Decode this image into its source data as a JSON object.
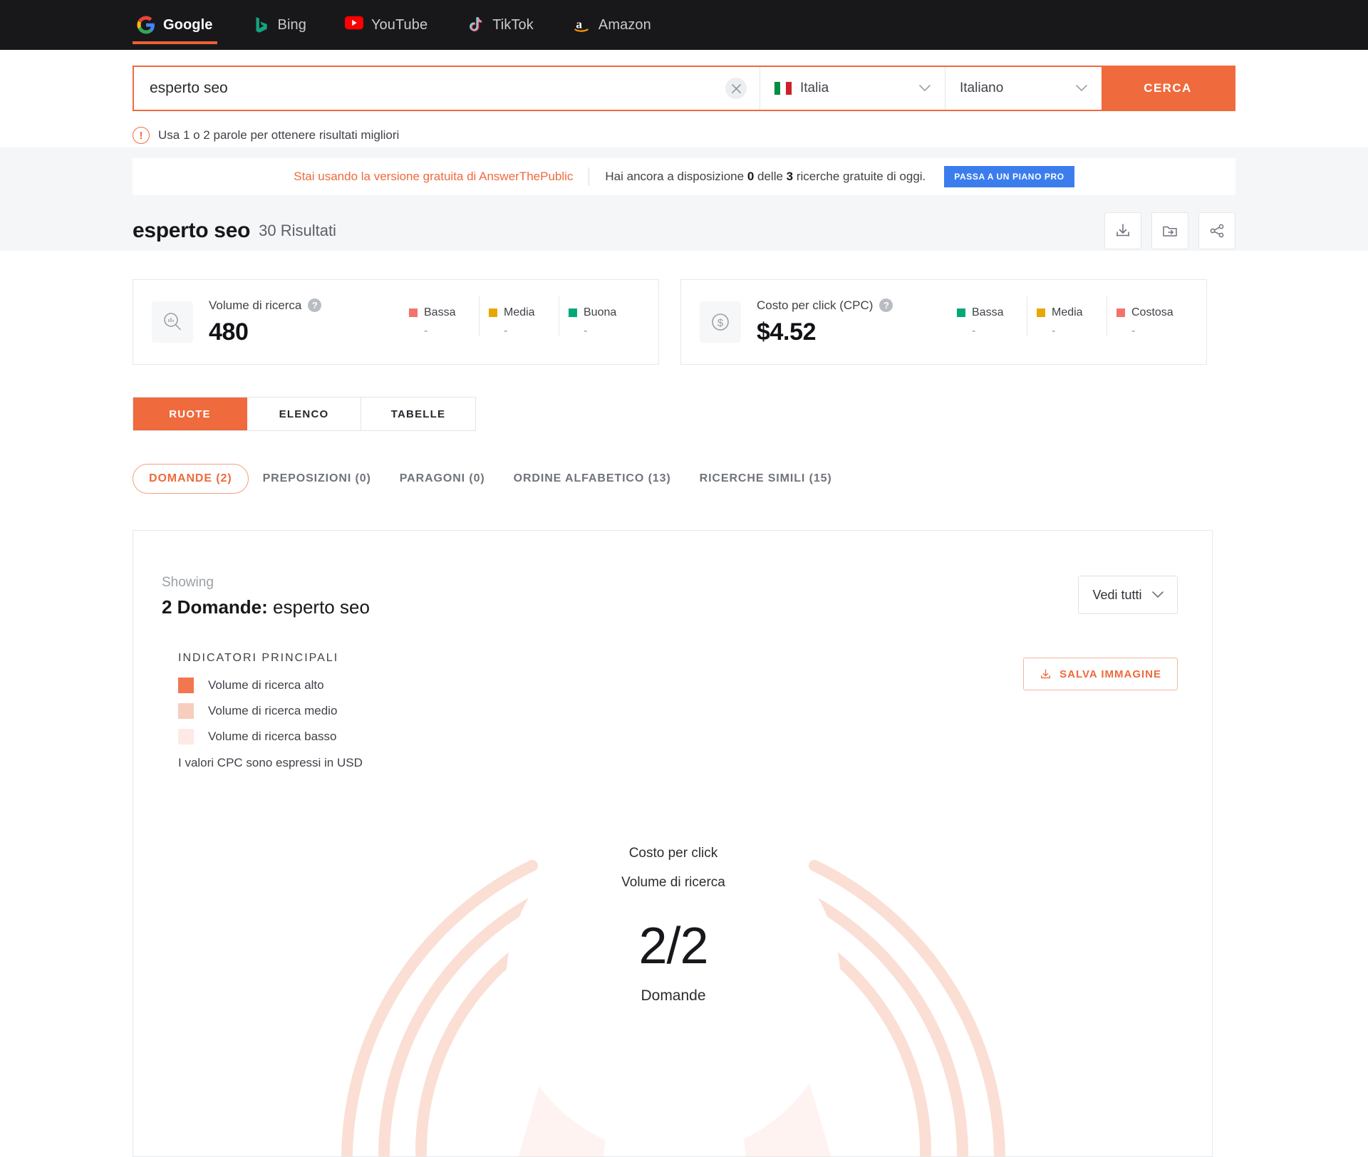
{
  "engines": [
    {
      "name": "Google",
      "icon": "google-icon",
      "active": true
    },
    {
      "name": "Bing",
      "icon": "bing-icon",
      "active": false
    },
    {
      "name": "YouTube",
      "icon": "youtube-icon",
      "active": false
    },
    {
      "name": "TikTok",
      "icon": "tiktok-icon",
      "active": false
    },
    {
      "name": "Amazon",
      "icon": "amazon-icon",
      "active": false
    }
  ],
  "search": {
    "value": "esperto seo",
    "placeholder": "esperto seo",
    "clear_icon": "close-icon",
    "country": "Italia",
    "country_flag": "italy-flag-icon",
    "language": "Italiano",
    "submit_label": "CERCA",
    "chevron_icon": "chevron-down-icon"
  },
  "hint": {
    "icon": "warning-icon",
    "text": "Usa 1 o 2 parole per ottenere risultati migliori"
  },
  "banner": {
    "free_text": "Stai usando la versione gratuita di AnswerThePublic",
    "quota_prefix": "Hai ancora a disposizione ",
    "quota_used": "0",
    "quota_middle": " delle ",
    "quota_total": "3",
    "quota_suffix": " ricerche gratuite di oggi.",
    "pro_label": "PASSA A UN PIANO PRO",
    "pro_color": "#3b7ded"
  },
  "results_header": {
    "keyword": "esperto seo",
    "count_label": "30 Risultati",
    "actions": [
      {
        "name": "download-icon",
        "label": "Download"
      },
      {
        "name": "move-to-folder-icon",
        "label": "Sposta"
      },
      {
        "name": "share-icon",
        "label": "Condividi"
      }
    ]
  },
  "cards": [
    {
      "icon": "search-volume-icon",
      "title": "Volume di ricerca",
      "help_icon": "question-mark-icon",
      "value": "480",
      "legend": [
        {
          "label": "Bassa",
          "color": "#f4726d",
          "value": "-"
        },
        {
          "label": "Media",
          "color": "#e8a700",
          "value": "-"
        },
        {
          "label": "Buona",
          "color": "#00a878",
          "value": "-"
        }
      ]
    },
    {
      "icon": "cpc-dollar-icon",
      "title": "Costo per click (CPC)",
      "help_icon": "question-mark-icon",
      "value": "$4.52",
      "legend": [
        {
          "label": "Bassa",
          "color": "#00a878",
          "value": "-"
        },
        {
          "label": "Media",
          "color": "#e8a700",
          "value": "-"
        },
        {
          "label": "Costosa",
          "color": "#f4726d",
          "value": "-"
        }
      ]
    }
  ],
  "view_tabs": [
    {
      "label": "RUOTE",
      "active": true
    },
    {
      "label": "ELENCO",
      "active": false
    },
    {
      "label": "TABELLE",
      "active": false
    }
  ],
  "category_tabs": [
    {
      "label": "DOMANDE (2)",
      "active": true
    },
    {
      "label": "PREPOSIZIONI (0)",
      "active": false
    },
    {
      "label": "PARAGONI (0)",
      "active": false
    },
    {
      "label": "ORDINE ALFABETICO (13)",
      "active": false
    },
    {
      "label": "RICERCHE SIMILI (15)",
      "active": false
    }
  ],
  "panel": {
    "showing_label": "Showing",
    "showing_count": "2 Domande:",
    "showing_keyword": "esperto seo",
    "view_all_label": "Vedi tutti",
    "view_all_icon": "chevron-down-icon",
    "indicators_title": "INDICATORI PRINCIPALI",
    "indicators": [
      {
        "label": "Volume di ricerca alto",
        "color": "#f2764f"
      },
      {
        "label": "Volume di ricerca medio",
        "color": "#f7cdbd"
      },
      {
        "label": "Volume di ricerca basso",
        "color": "#fdeae4"
      }
    ],
    "cpc_note": "I valori CPC sono espressi in USD",
    "save_image_label": "SALVA IMMAGINE",
    "save_image_icon": "download-icon"
  },
  "wheel": {
    "legend_line1": "Costo per click",
    "legend_line2": "Volume di ricerca",
    "fraction": "2/2",
    "fraction_sub": "Domande",
    "arc_color": "#fbdfd4"
  },
  "chart_data": {
    "type": "pie",
    "title": "2/2 Domande",
    "categories": [
      "Domande"
    ],
    "values": [
      2
    ],
    "total": 2,
    "arc_segments": 2,
    "legend": [
      "Costo per click",
      "Volume di ricerca"
    ],
    "colors": [
      "#f2764f",
      "#f7cdbd",
      "#fdeae4"
    ]
  }
}
